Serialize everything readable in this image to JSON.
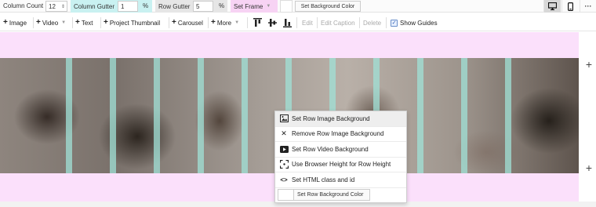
{
  "grid": {
    "column_count_label": "Column Count",
    "column_count_value": "12",
    "column_gutter_label": "Column Gutter",
    "column_gutter_value": "1",
    "column_gutter_unit": "%",
    "row_gutter_label": "Row Gutter",
    "row_gutter_value": "5",
    "row_gutter_unit": "%",
    "set_frame_label": "Set Frame",
    "set_bg_color_label": "Set Background Color",
    "accent_cyan": "#c9f1f1",
    "accent_gray": "#e6e6e6",
    "accent_pink": "#f7d3f4"
  },
  "views": {
    "desktop_icon": "monitor-icon",
    "mobile_icon": "phone-icon",
    "more_icon": "ellipsis-icon",
    "more_glyph": "···"
  },
  "insert_bar": {
    "plus_glyph": "+",
    "image": "Image",
    "video": "Video",
    "text": "Text",
    "project_thumbnail": "Project Thumbnail",
    "carousel": "Carousel",
    "more": "More",
    "align_top_icon": "align-top-icon",
    "align_middle_icon": "align-middle-icon",
    "align_bottom_icon": "align-bottom-icon",
    "edit": "Edit",
    "edit_caption": "Edit Caption",
    "delete": "Delete",
    "show_guides": "Show Guides",
    "show_guides_checked": true
  },
  "canvas": {
    "background": "#fbe0fb",
    "guide_color": "#a0e1d7",
    "add_row_glyph": "+"
  },
  "context_menu": {
    "items": [
      {
        "icon": "image-icon",
        "label": "Set Row Image Background",
        "glyph": "▣"
      },
      {
        "icon": "close-icon",
        "label": "Remove Row Image Background",
        "glyph": "✕"
      },
      {
        "icon": "video-icon",
        "label": "Set Row Video Background",
        "glyph": "▶"
      },
      {
        "icon": "expand-icon",
        "label": "Use Browser Height for Row Height",
        "glyph": "⤢"
      },
      {
        "icon": "code-icon",
        "label": "Set HTML class and id",
        "glyph": "<>"
      }
    ],
    "color_button_label": "Set Row Background Color"
  }
}
